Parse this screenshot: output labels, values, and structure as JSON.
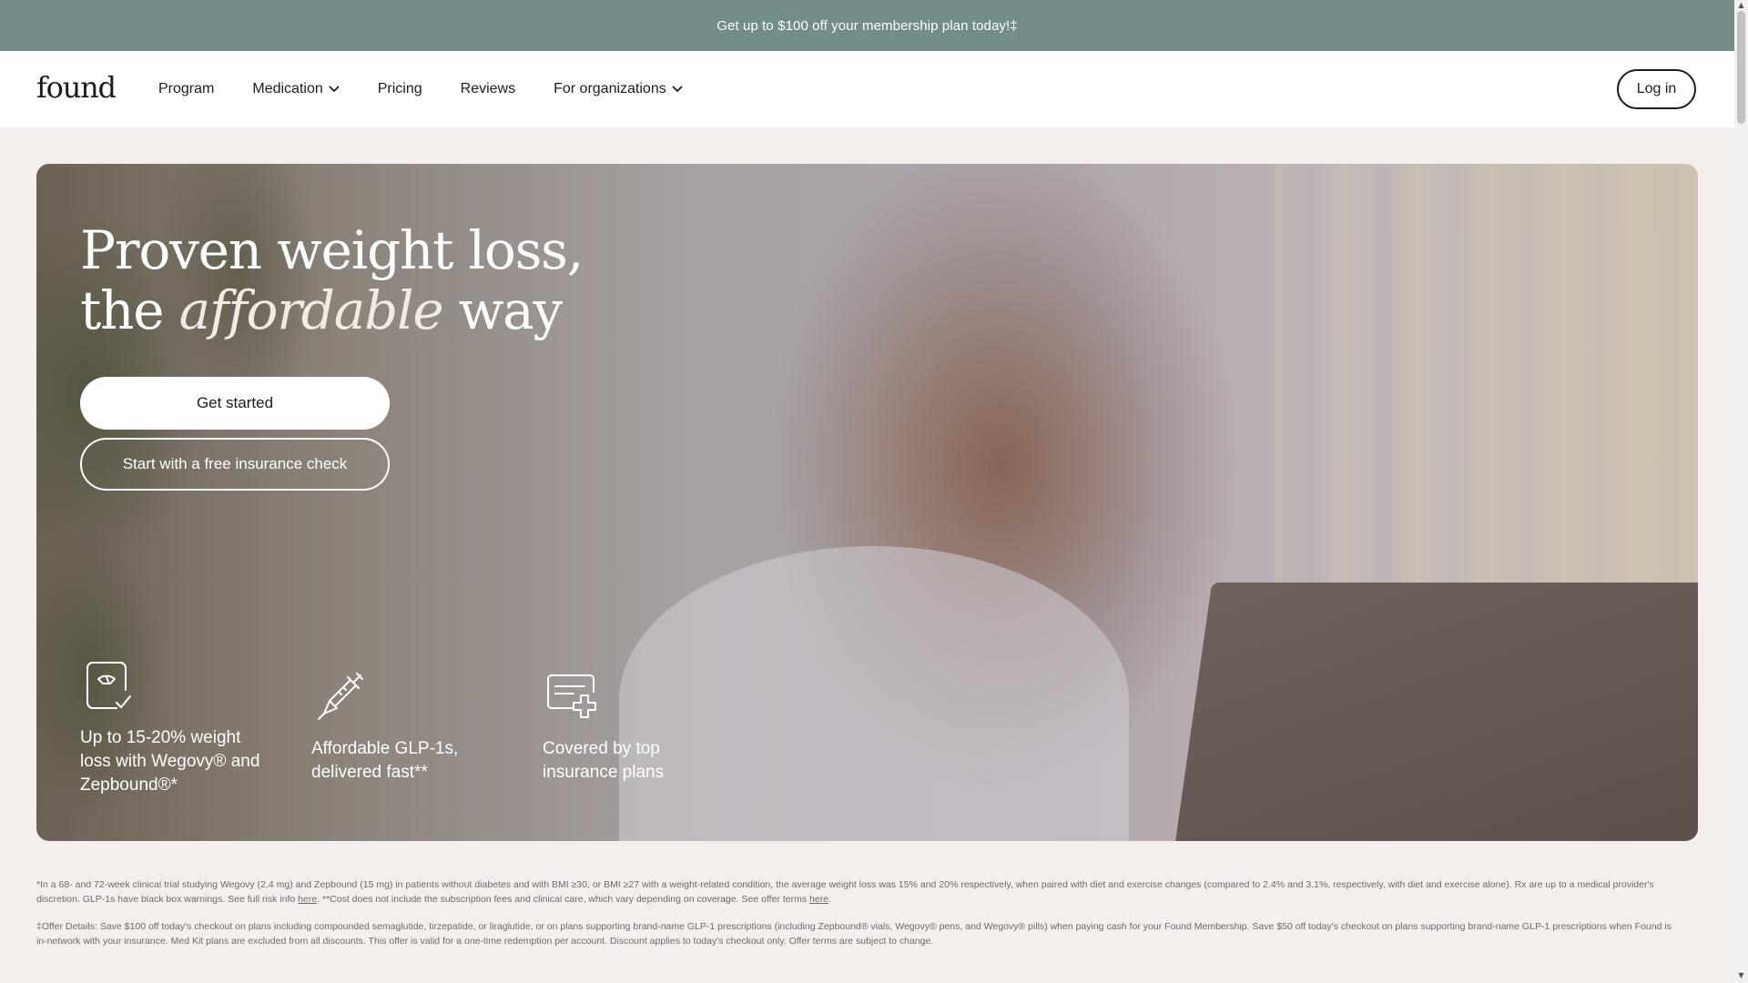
{
  "promo": {
    "text": "Get up to $100 off your membership plan today!‡"
  },
  "header": {
    "logo": "found",
    "nav": [
      {
        "label": "Program",
        "has_dropdown": false
      },
      {
        "label": "Medication",
        "has_dropdown": true
      },
      {
        "label": "Pricing",
        "has_dropdown": false
      },
      {
        "label": "Reviews",
        "has_dropdown": false
      },
      {
        "label": "For organizations",
        "has_dropdown": true
      }
    ],
    "login_label": "Log in"
  },
  "hero": {
    "headline_line1": "Proven weight loss,",
    "headline_line2_start": "the ",
    "headline_line2_emph": "affordable",
    "headline_line2_end": " way",
    "primary_cta": "Get started",
    "secondary_cta": "Start with a free insurance check",
    "features": [
      {
        "icon": "scale-check-icon",
        "text_line1": "Up to 15-20% weight",
        "text_line2": "loss with Wegovy® and",
        "text_line3": "Zepbound®*"
      },
      {
        "icon": "syringe-icon",
        "text_line1": "Affordable GLP-1s,",
        "text_line2": "delivered fast**",
        "text_line3": ""
      },
      {
        "icon": "insurance-card-icon",
        "text_line1": "Covered by top",
        "text_line2": "insurance plans",
        "text_line3": ""
      }
    ]
  },
  "footnotes": {
    "note1_a": "*In a 68- and 72-week clinical trial studying Wegovy (2.4 mg) and Zepbound (15 mg) in patients without diabetes and with BMI ≥30, or BMI ≥27 with a weight-related condition, the average weight loss was 15% and 20% respectively, when paired with diet and exercise changes (compared to 2.4% and 3.1%, respectively, with diet and exercise alone). Rx are up to a medical provider's discretion. GLP-1s have black box warnings. See full risk info ",
    "note1_link1": "here",
    "note1_b": ". **Cost does not include the subscription fees and clinical care, which vary depending on coverage. See offer terms ",
    "note1_link2": "here",
    "note1_c": ".",
    "note2": "‡Offer Details: Save $100 off today's checkout on plans including compounded semaglutide, tirzepatide, or liraglutide, or on plans supporting brand-name GLP-1 prescriptions (including Zepbound® vials, Wegovy® pens, and Wegovy® pills) when paying cash for your Found Membership. Save $50 off today's checkout on plans supporting brand-name GLP-1 prescriptions when Found is in-network with your insurance. Med Kit plans are excluded from all discounts. This offer is valid for a one-time redemption per account. Discount applies to today's checkout only. Offer terms are subject to change."
  }
}
